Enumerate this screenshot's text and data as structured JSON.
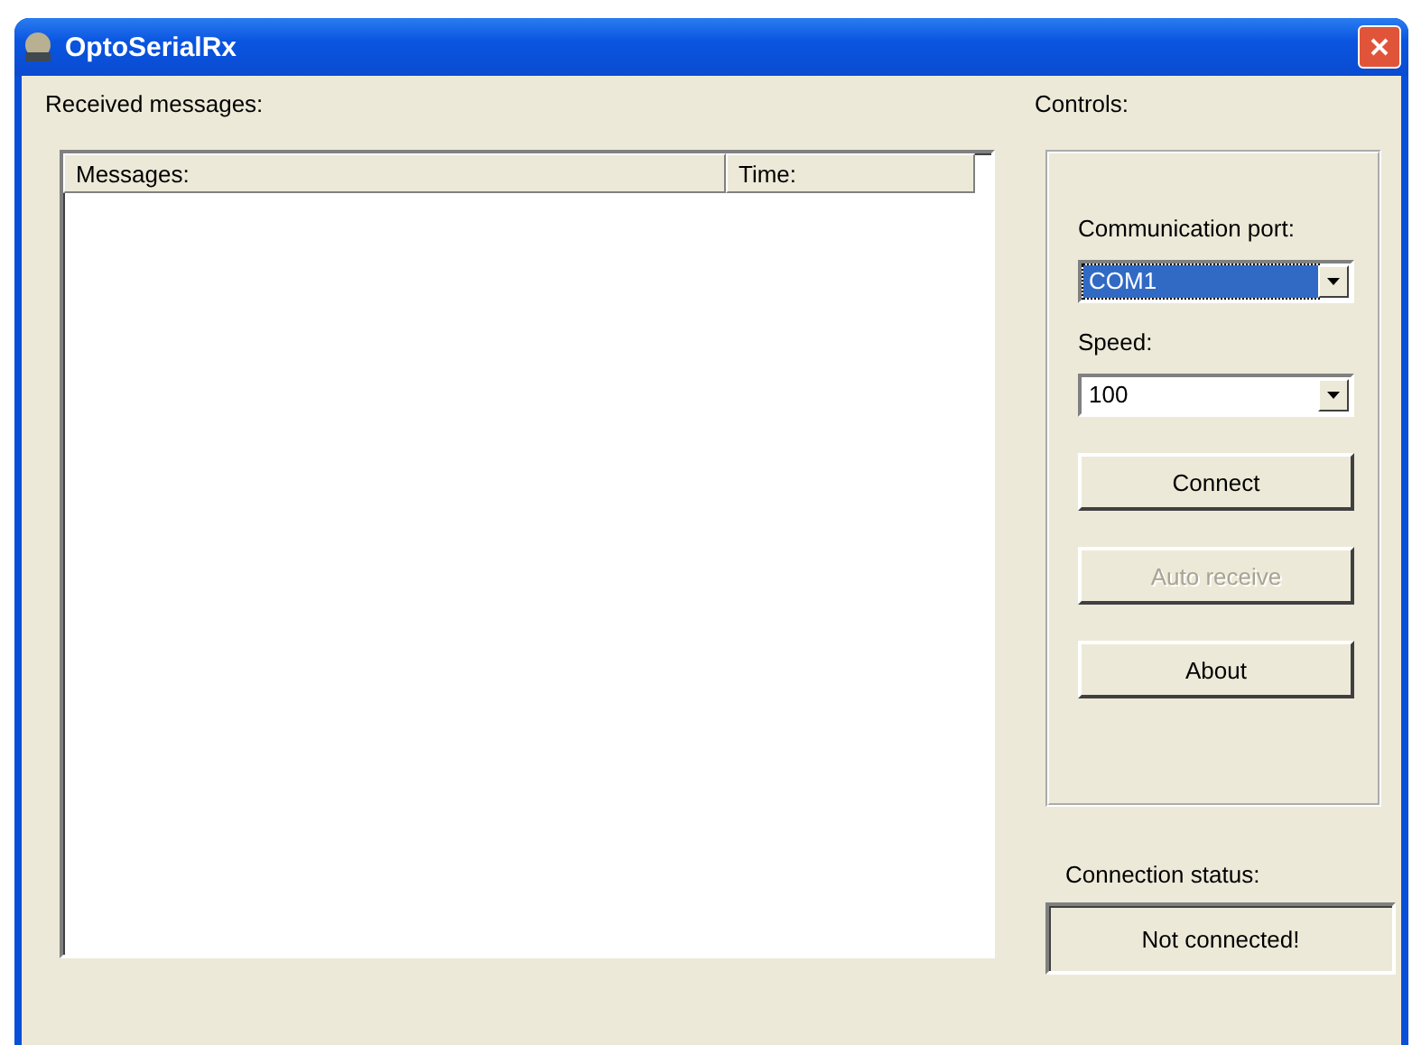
{
  "window": {
    "title": "OptoSerialRx"
  },
  "messages": {
    "label": "Received messages:",
    "columns": [
      "Messages:",
      "Time:"
    ]
  },
  "controls": {
    "label": "Controls:",
    "port": {
      "label": "Communication port:",
      "value": "COM1",
      "highlighted": true
    },
    "speed": {
      "label": "Speed:",
      "value": "100",
      "highlighted": false
    },
    "buttons": [
      {
        "label": "Connect",
        "disabled": false
      },
      {
        "label": "Auto receive",
        "disabled": true
      },
      {
        "label": "About",
        "disabled": false
      }
    ]
  },
  "status": {
    "label": "Connection status:",
    "value": "Not connected!"
  }
}
